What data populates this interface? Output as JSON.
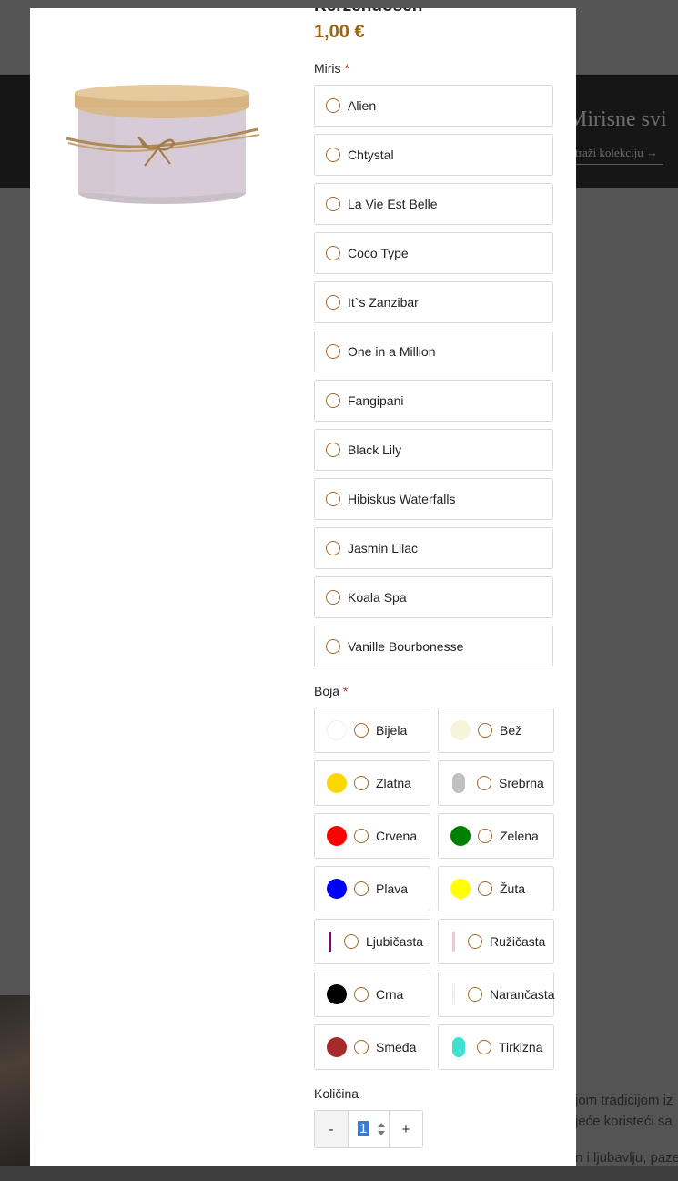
{
  "background": {
    "banner_title": "Mirisne svi",
    "banner_link": "traži kolekciju →",
    "text_lines": [
      "jom tradicijom iz",
      "jeće koristeći sa",
      "n i ljubavlju, paze"
    ]
  },
  "modal": {
    "title": "Kerzendosen",
    "price": "1,00 €",
    "scent": {
      "label": "Miris",
      "required_mark": "*",
      "options": [
        "Alien",
        "Chtystal",
        "La Vie Est Belle",
        "Coco Type",
        "It`s Zanzibar",
        "One in a Million",
        "Fangipani",
        "Black Lily",
        "Hibiskus Waterfalls",
        "Jasmin Lilac",
        "Koala Spa",
        "Vanille Bourbonesse"
      ]
    },
    "color": {
      "label": "Boja",
      "required_mark": "*",
      "options": [
        {
          "name": "Bijela",
          "swatch": "#ffffff",
          "style": "dot"
        },
        {
          "name": "Bež",
          "swatch": "#f5f5dc",
          "style": "dot"
        },
        {
          "name": "Zlatna",
          "swatch": "#ffd700",
          "style": "dot"
        },
        {
          "name": "Srebrna",
          "swatch": "#c0c0c0",
          "style": "pill"
        },
        {
          "name": "Crvena",
          "swatch": "#ff0000",
          "style": "dot"
        },
        {
          "name": "Zelena",
          "swatch": "#008000",
          "style": "dot"
        },
        {
          "name": "Plava",
          "swatch": "#0000ff",
          "style": "dot"
        },
        {
          "name": "Žuta",
          "swatch": "#ffff00",
          "style": "dot"
        },
        {
          "name": "Ljubičasta",
          "swatch": "#800080",
          "style": "line"
        },
        {
          "name": "Ružičasta",
          "swatch": "#ffc0cb",
          "style": "line"
        },
        {
          "name": "Crna",
          "swatch": "#000000",
          "style": "dot"
        },
        {
          "name": "Narančasta",
          "swatch": "#f4f4f4",
          "style": "line"
        },
        {
          "name": "Smeđa",
          "swatch": "#a52a2a",
          "style": "dot"
        },
        {
          "name": "Tirkizna",
          "swatch": "#40e0d0",
          "style": "pill"
        }
      ]
    },
    "quantity": {
      "label": "Količina",
      "minus": "-",
      "plus": "+",
      "value": "1"
    }
  }
}
